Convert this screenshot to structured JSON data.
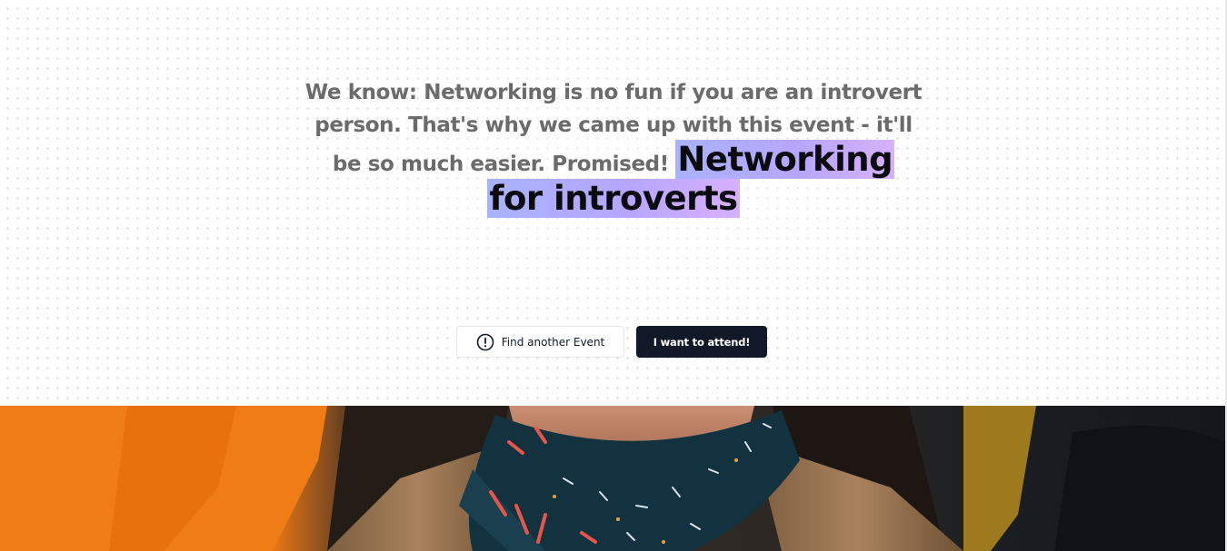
{
  "headline": {
    "intro": "We know: Networking is no fun if you are an introvert person. That's why we came up with this event - it'll be so much easier. Promised!",
    "title": "Networking for introverts"
  },
  "actions": {
    "secondary_label": "Find another Event",
    "secondary_icon": "alert-circle-icon",
    "primary_label": "I want to attend!"
  },
  "colors": {
    "primary_button": "#111827",
    "highlight_start": "#a9b2ff",
    "highlight_end": "#d7b0ff",
    "intro_text": "#6b6b6b"
  },
  "hero_image": {
    "description_icon": "event-photo"
  }
}
